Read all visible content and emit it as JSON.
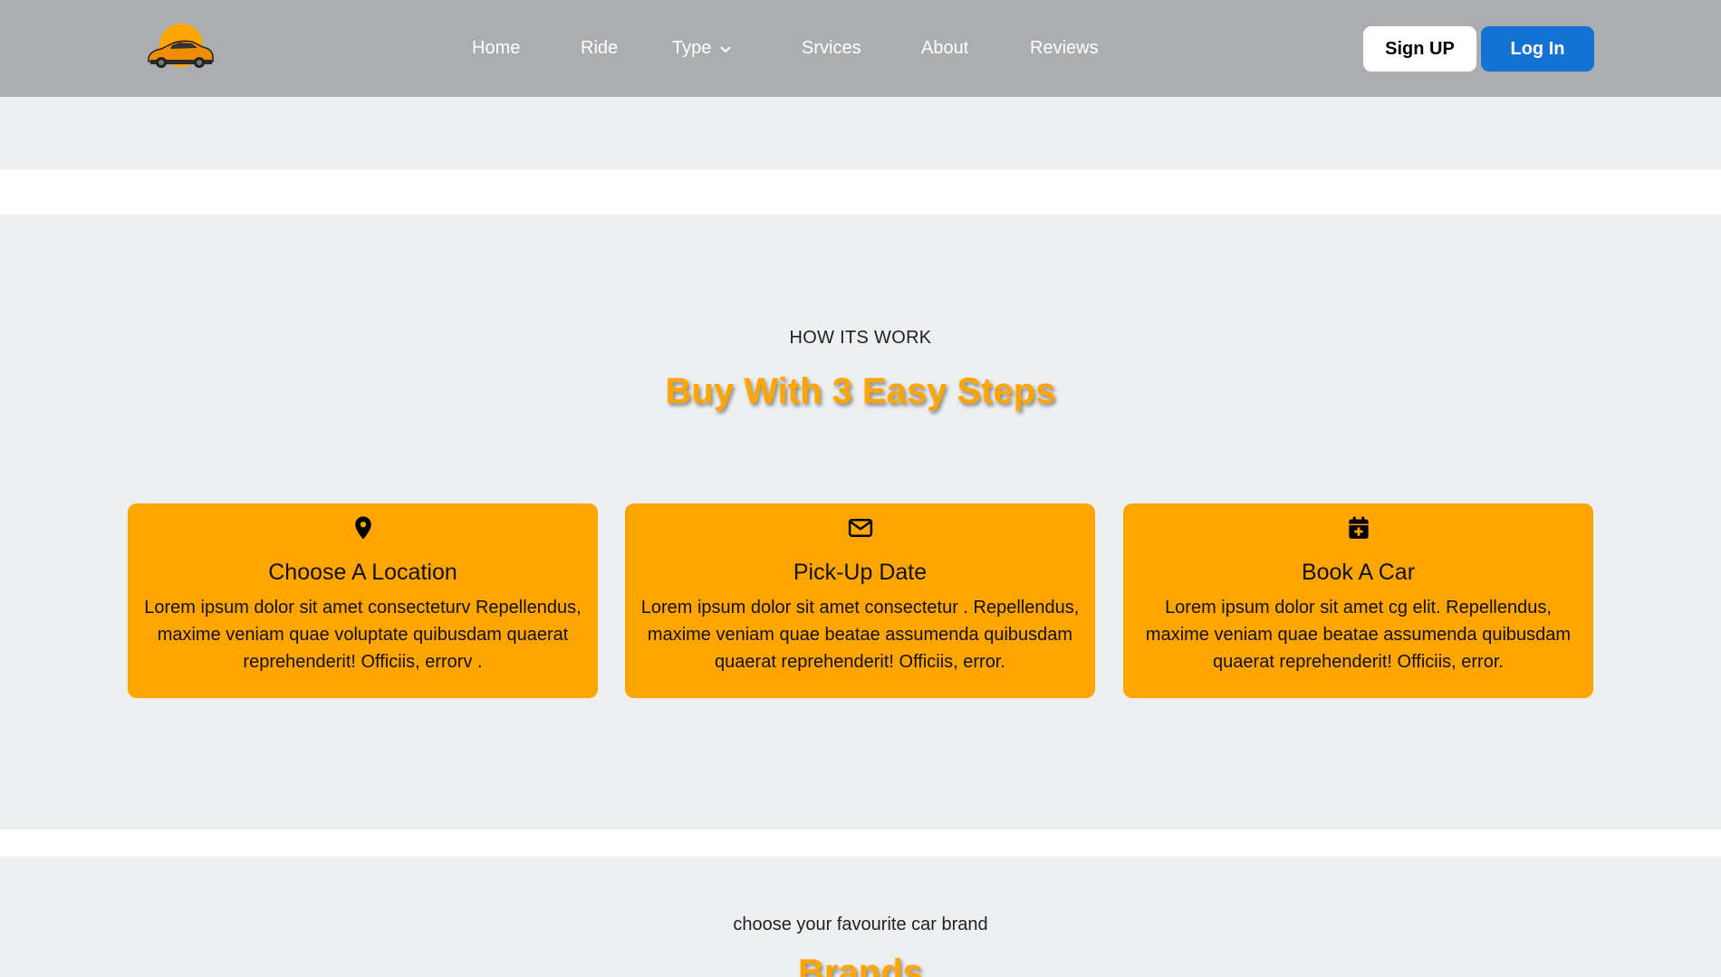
{
  "nav": {
    "links": [
      "Home",
      "Ride",
      "Type",
      "Srvices",
      "About",
      "Reviews"
    ],
    "signup_label": "Sign UP",
    "login_label": "Log In"
  },
  "how": {
    "subtitle": "HOW ITS WORK",
    "title": "Buy With 3 Easy Steps",
    "cards": [
      {
        "icon": "location-pin-icon",
        "title": "Choose A Location",
        "text": "Lorem ipsum dolor sit amet consecteturv Repellendus, maxime veniam quae voluptate quibusdam quaerat reprehenderit! Officiis, errorv ."
      },
      {
        "icon": "envelope-icon",
        "title": "Pick-Up Date",
        "text": "Lorem ipsum dolor sit amet consectetur . Repellendus, maxime veniam quae beatae assumenda quibusdam quaerat reprehenderit! Officiis, error."
      },
      {
        "icon": "calendar-plus-icon",
        "title": "Book A Car",
        "text": "Lorem ipsum dolor sit amet cg elit. Repellendus, maxime veniam quae beatae assumenda quibusdam quaerat reprehenderit! Officiis, error."
      }
    ]
  },
  "brands": {
    "subtitle": "choose your favourite car brand",
    "title": "Brands"
  },
  "colors": {
    "navbar": "#acadaf",
    "accent": "#ffa500",
    "login_button": "#1273d4",
    "page_bg": "#eeeff1"
  }
}
